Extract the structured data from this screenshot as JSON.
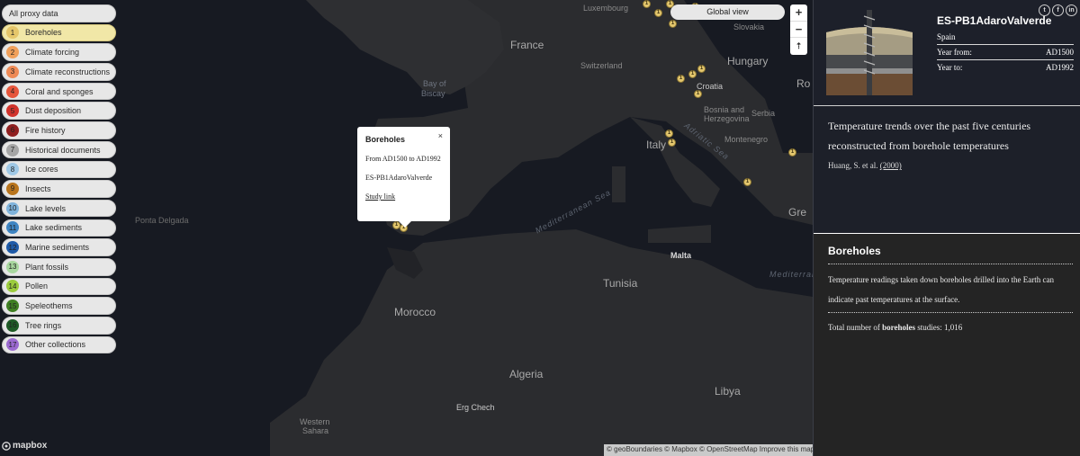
{
  "proxy_list": {
    "all_label": "All proxy data",
    "items": [
      {
        "num": "1",
        "label": "Boreholes",
        "color": "#e5c66a",
        "active": true
      },
      {
        "num": "2",
        "label": "Climate forcing",
        "color": "#f0a05b"
      },
      {
        "num": "3",
        "label": "Climate reconstructions",
        "color": "#ee8a56"
      },
      {
        "num": "4",
        "label": "Coral and sponges",
        "color": "#e6553b"
      },
      {
        "num": "5",
        "label": "Dust deposition",
        "color": "#d1322b"
      },
      {
        "num": "6",
        "label": "Fire history",
        "color": "#8f1f1f"
      },
      {
        "num": "7",
        "label": "Historical documents",
        "color": "#a6a6a6"
      },
      {
        "num": "8",
        "label": "Ice cores",
        "color": "#9fc8e6"
      },
      {
        "num": "9",
        "label": "Insects",
        "color": "#b8741d"
      },
      {
        "num": "10",
        "label": "Lake levels",
        "color": "#7fb3dc"
      },
      {
        "num": "11",
        "label": "Lake sediments",
        "color": "#3e84c2"
      },
      {
        "num": "12",
        "label": "Marine sediments",
        "color": "#1e5aa8"
      },
      {
        "num": "13",
        "label": "Plant fossils",
        "color": "#a9d8a0"
      },
      {
        "num": "14",
        "label": "Pollen",
        "color": "#9ccc3e"
      },
      {
        "num": "15",
        "label": "Speleothems",
        "color": "#3f7f22"
      },
      {
        "num": "16",
        "label": "Tree rings",
        "color": "#1e5a26"
      },
      {
        "num": "17",
        "label": "Other collections",
        "color": "#9b6ad0"
      }
    ]
  },
  "popup": {
    "title": "Boreholes",
    "close": "×",
    "range": "From AD1500 to AD1992",
    "site": "ES-PB1AdaroValverde",
    "link": "Study link"
  },
  "map_controls": {
    "global_view": "Global view",
    "zoom_in": "+",
    "zoom_out": "−",
    "reset": "⇡"
  },
  "map_labels": {
    "france": "France",
    "bay": "Bay of",
    "biscay": "Biscay",
    "italy": "Italy",
    "hungary": "Hungary",
    "croatia": "Croatia",
    "bosnia": "Bosnia and",
    "herzegovina": "Herzegovina",
    "serbia": "Serbia",
    "montenegro": "Montenegro",
    "tunisia": "Tunisia",
    "malta": "Malta",
    "morocco": "Morocco",
    "algeria": "Algeria",
    "libya": "Libya",
    "luxembourg": "Luxembourg",
    "switzerland": "Switzerland",
    "slovakia": "Slovakia",
    "western": "Western",
    "sahara": "Sahara",
    "erg": "Erg Chech",
    "ponta": "Ponta Delgada",
    "adriatic": "Adriatic Sea",
    "medsea": "Mediterranean Sea",
    "medsea2": "Mediterranea",
    "gre": "Gre",
    "ro": "Ro"
  },
  "brand": {
    "mapbox": "mapbox"
  },
  "attribution": "© geoBoundaries © Mapbox © OpenStreetMap Improve this map",
  "site_panel": {
    "title": "ES-PB1AdaroValverde",
    "country": "Spain",
    "year_from_label": "Year from:",
    "year_from": "AD1500",
    "year_to_label": "Year to:",
    "year_to": "AD1992",
    "social": [
      "t",
      "f",
      "in"
    ]
  },
  "study": {
    "description": "Temperature trends over the past five centuries reconstructed from borehole temperatures",
    "author": "Huang, S. et al.",
    "year": "(2000)"
  },
  "proxy_info": {
    "title": "Boreholes",
    "description": "Temperature readings taken down boreholes drilled into the Earth can indicate past temperatures at the surface.",
    "total_prefix": "Total number of",
    "total_type": "boreholes",
    "total_suffix": "studies: 1,016"
  }
}
